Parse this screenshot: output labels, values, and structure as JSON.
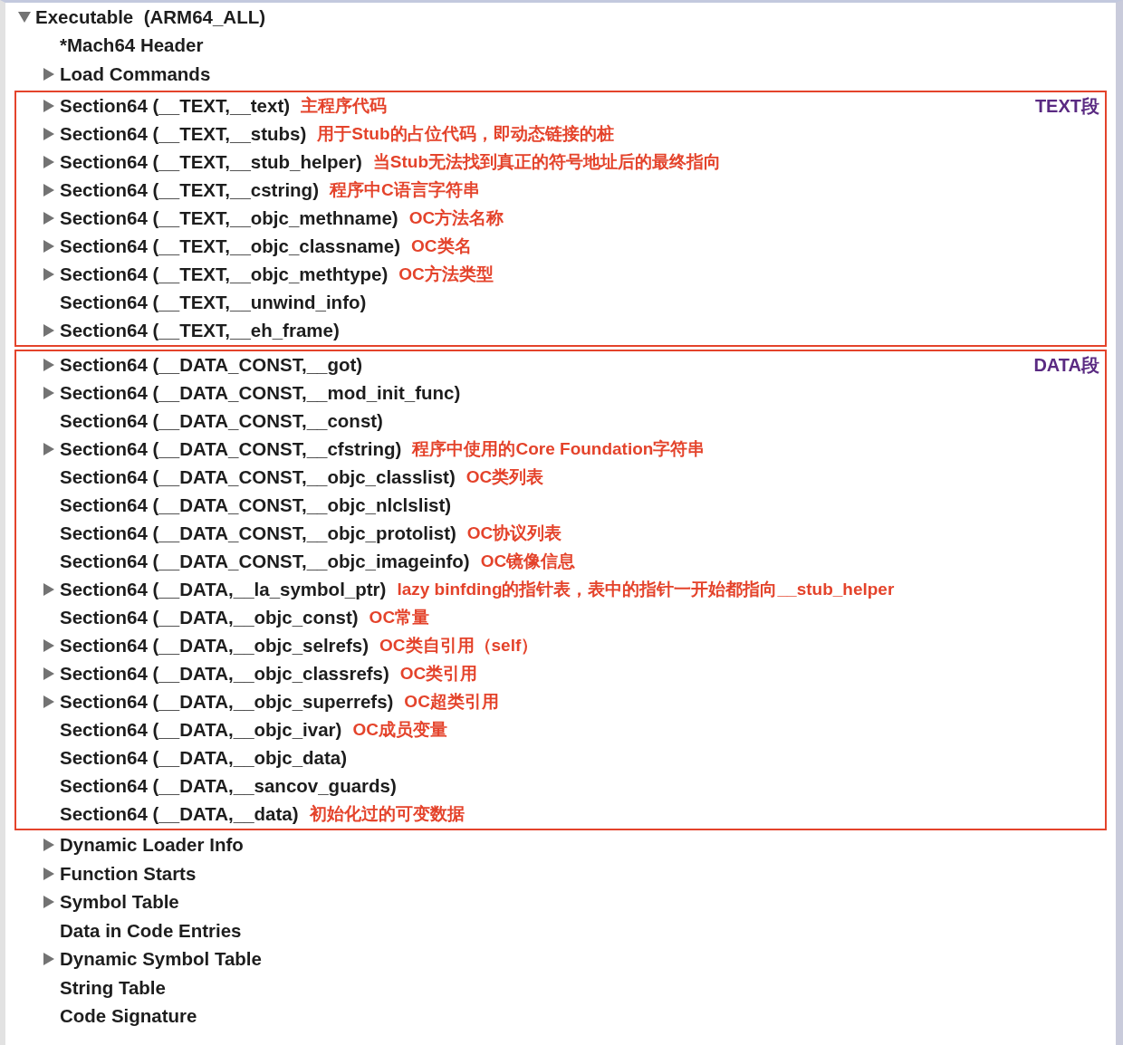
{
  "tree": {
    "label": "Executable  (ARM64_ALL)",
    "expanded": true,
    "children": [
      {
        "kind": "item",
        "label": "*Mach64 Header",
        "expandable": false
      },
      {
        "kind": "item",
        "label": "Load Commands",
        "expandable": true
      },
      {
        "kind": "box",
        "tag": "TEXT段",
        "rows": [
          {
            "label": "Section64 (__TEXT,__text)",
            "expandable": true,
            "note": "主程序代码"
          },
          {
            "label": "Section64 (__TEXT,__stubs)",
            "expandable": true,
            "note": "用于Stub的占位代码，即动态链接的桩"
          },
          {
            "label": "Section64 (__TEXT,__stub_helper)",
            "expandable": true,
            "note": "当Stub无法找到真正的符号地址后的最终指向"
          },
          {
            "label": "Section64 (__TEXT,__cstring)",
            "expandable": true,
            "note": "程序中C语言字符串"
          },
          {
            "label": "Section64 (__TEXT,__objc_methname)",
            "expandable": true,
            "note": "OC方法名称"
          },
          {
            "label": "Section64 (__TEXT,__objc_classname)",
            "expandable": true,
            "note": "OC类名"
          },
          {
            "label": "Section64 (__TEXT,__objc_methtype)",
            "expandable": true,
            "note": "OC方法类型"
          },
          {
            "label": "Section64 (__TEXT,__unwind_info)",
            "expandable": false
          },
          {
            "label": "Section64 (__TEXT,__eh_frame)",
            "expandable": true
          }
        ]
      },
      {
        "kind": "box",
        "tag": "DATA段",
        "rows": [
          {
            "label": "Section64 (__DATA_CONST,__got)",
            "expandable": true
          },
          {
            "label": "Section64 (__DATA_CONST,__mod_init_func)",
            "expandable": true
          },
          {
            "label": "Section64 (__DATA_CONST,__const)",
            "expandable": false
          },
          {
            "label": "Section64 (__DATA_CONST,__cfstring)",
            "expandable": true,
            "note": "程序中使用的Core Foundation字符串"
          },
          {
            "label": "Section64 (__DATA_CONST,__objc_classlist)",
            "expandable": false,
            "note": "OC类列表"
          },
          {
            "label": "Section64 (__DATA_CONST,__objc_nlclslist)",
            "expandable": false
          },
          {
            "label": "Section64 (__DATA_CONST,__objc_protolist)",
            "expandable": false,
            "note": "OC协议列表"
          },
          {
            "label": "Section64 (__DATA_CONST,__objc_imageinfo)",
            "expandable": false,
            "note": "OC镜像信息"
          },
          {
            "label": "Section64 (__DATA,__la_symbol_ptr)",
            "expandable": true,
            "note": "lazy binfding的指针表，表中的指针一开始都指向__stub_helper"
          },
          {
            "label": "Section64 (__DATA,__objc_const)",
            "expandable": false,
            "note": "OC常量"
          },
          {
            "label": "Section64 (__DATA,__objc_selrefs)",
            "expandable": true,
            "note": "OC类自引用（self）"
          },
          {
            "label": "Section64 (__DATA,__objc_classrefs)",
            "expandable": true,
            "note": "OC类引用"
          },
          {
            "label": "Section64 (__DATA,__objc_superrefs)",
            "expandable": true,
            "note": "OC超类引用"
          },
          {
            "label": "Section64 (__DATA,__objc_ivar)",
            "expandable": false,
            "note": "OC成员变量"
          },
          {
            "label": "Section64 (__DATA,__objc_data)",
            "expandable": false
          },
          {
            "label": "Section64 (__DATA,__sancov_guards)",
            "expandable": false
          },
          {
            "label": "Section64 (__DATA,__data)",
            "expandable": false,
            "note": "初始化过的可变数据"
          }
        ]
      },
      {
        "kind": "item",
        "label": "Dynamic Loader Info",
        "expandable": true
      },
      {
        "kind": "item",
        "label": "Function Starts",
        "expandable": true
      },
      {
        "kind": "item",
        "label": "Symbol Table",
        "expandable": true
      },
      {
        "kind": "item",
        "label": "Data in Code Entries",
        "expandable": false
      },
      {
        "kind": "item",
        "label": "Dynamic Symbol Table",
        "expandable": true
      },
      {
        "kind": "item",
        "label": "String Table",
        "expandable": false
      },
      {
        "kind": "item",
        "label": "Code Signature",
        "expandable": false
      }
    ]
  }
}
